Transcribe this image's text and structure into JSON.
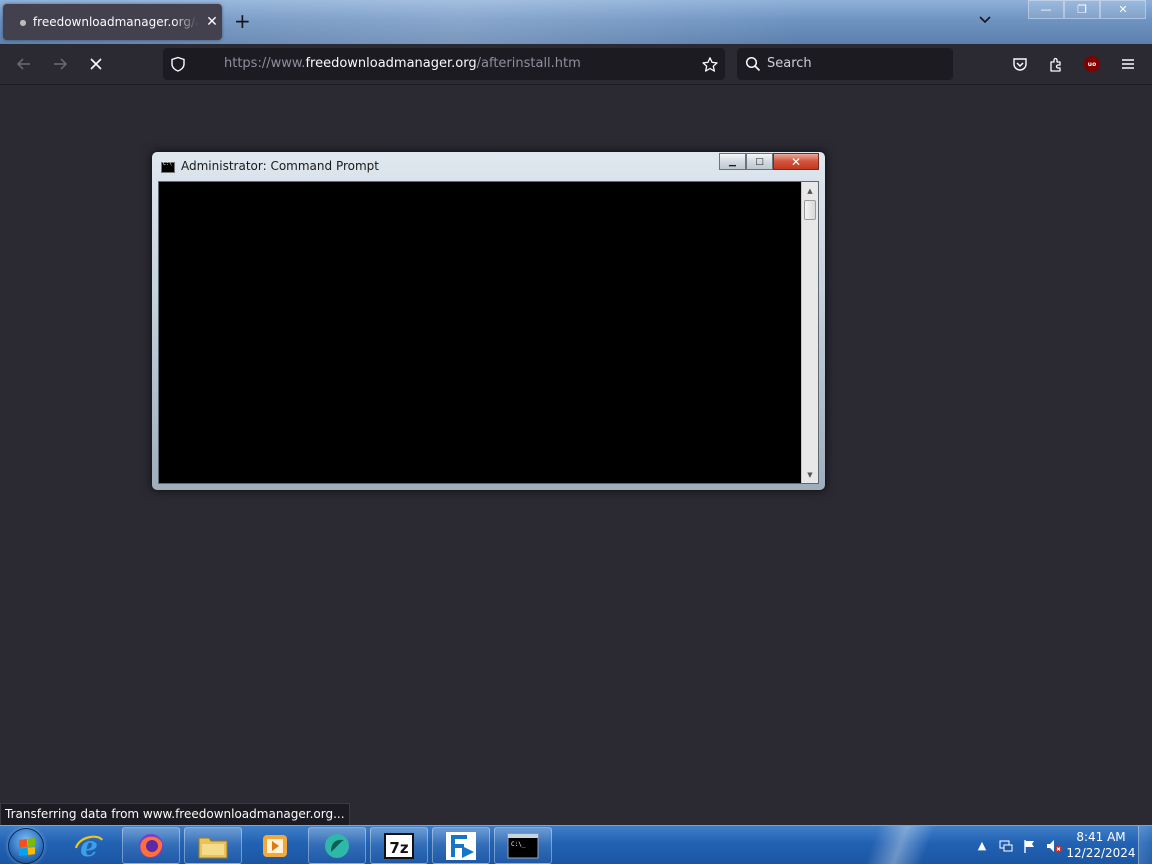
{
  "browser": {
    "tab": {
      "title": "freedownloadmanager.org/afterinstall.htm",
      "close_glyph": "✕"
    },
    "new_tab_glyph": "+",
    "url": {
      "scheme_prefix": "https://www.",
      "host": "freedownloadmanager.org",
      "path": "/afterinstall.htm"
    },
    "search_placeholder": "Search",
    "status_text": "Transferring data from www.freedownloadmanager.org...",
    "window_controls": {
      "minimize": "—",
      "restore": "❐",
      "close": "✕"
    },
    "icons": [
      "back-arrow-icon",
      "forward-arrow-icon",
      "stop-loading-icon",
      "tracking-shield-icon",
      "bookmark-star-icon",
      "search-icon",
      "pocket-icon",
      "extensions-icon",
      "ublock-icon",
      "hamburger-menu-icon"
    ]
  },
  "cmd_window": {
    "title": "Administrator:  Command Prompt",
    "controls": {
      "minimize": "▁",
      "maximize": "□",
      "close": "✕"
    }
  },
  "taskbar": {
    "apps": [
      "internet-explorer",
      "firefox",
      "file-explorer",
      "media-player",
      "browser-app",
      "7-zip",
      "freedownloadmanager",
      "command-prompt"
    ],
    "seven_zip_label": "7z",
    "clock": {
      "time": "8:41 AM",
      "date": "12/22/2024"
    }
  },
  "colors": {
    "browser_bg": "#2b2a33",
    "url_field": "#1c1b22",
    "taskbar": "#2262b3"
  }
}
